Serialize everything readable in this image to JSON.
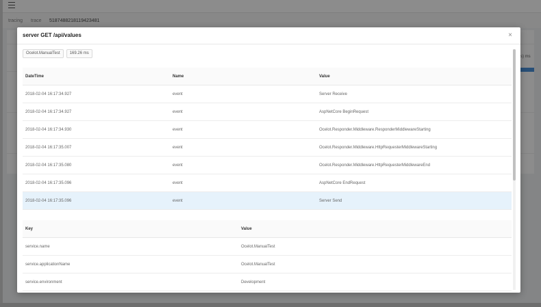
{
  "background": {
    "breadcrumb": [
      "tracing",
      "trace"
    ],
    "trace_id": "5187488218119423481",
    "side_label": "s) ms"
  },
  "modal": {
    "title": "server GET /api/values",
    "close_glyph": "×",
    "tags": [
      "Ocelot.ManualTest",
      "169.26 ms"
    ],
    "logs": {
      "columns": [
        "DateTime",
        "Name",
        "Value"
      ],
      "rows": [
        {
          "datetime": "2018-02-04 16:17:34.927",
          "name": "event",
          "value": "Server Receive"
        },
        {
          "datetime": "2018-02-04 16:17:34.927",
          "name": "event",
          "value": "AspNetCore BeginRequest"
        },
        {
          "datetime": "2018-02-04 16:17:34.930",
          "name": "event",
          "value": "Ocelot.Responder.Middleware.ResponderMiddlewareStarting"
        },
        {
          "datetime": "2018-02-04 16:17:35.007",
          "name": "event",
          "value": "Ocelot.Responder.Middleware.HttpRequesterMiddlewareStarting"
        },
        {
          "datetime": "2018-02-04 16:17:35.080",
          "name": "event",
          "value": "Ocelot.Responder.Middleware.HttpRequesterMiddlewareEnd"
        },
        {
          "datetime": "2018-02-04 16:17:35.096",
          "name": "event",
          "value": "AspNetCore EndRequest"
        },
        {
          "datetime": "2018-02-04 16:17:35.096",
          "name": "event",
          "value": "Server Send"
        }
      ],
      "selected_row": 6
    },
    "span_tags": {
      "columns": [
        "Key",
        "Value"
      ],
      "rows": [
        {
          "key": "service.name",
          "value": "Ocelot.ManualTest"
        },
        {
          "key": "service.applicationName",
          "value": "Ocelot.ManualTest"
        },
        {
          "key": "service.environment",
          "value": "Development"
        }
      ]
    }
  },
  "colors": {
    "selected_row": "#e6f2fb",
    "overlay": "rgba(0,0,0,0.45)",
    "accent": "#4a90d9"
  }
}
